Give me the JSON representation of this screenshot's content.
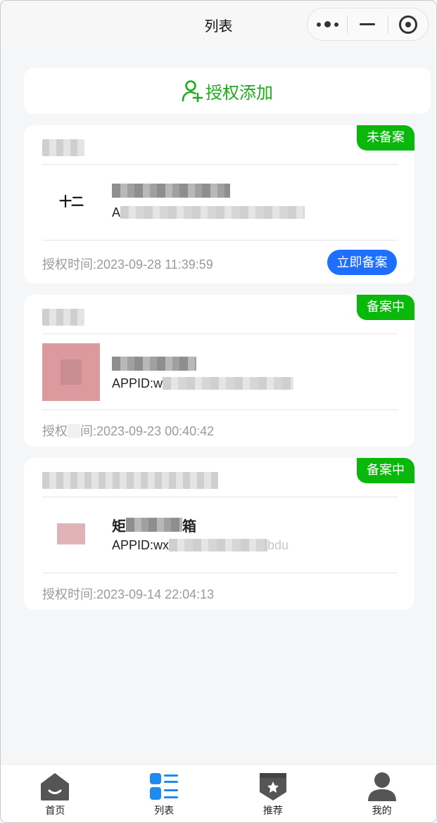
{
  "nav": {
    "title": "列表"
  },
  "auth_button": {
    "label": "授权添加"
  },
  "cards": [
    {
      "name": "",
      "status": "未备案",
      "logo_text": "十二",
      "appid_prefix": "A",
      "auth_time": "授权时间:2023-09-28 11:39:59",
      "action": "立即备案"
    },
    {
      "name": "",
      "status": "备案中",
      "appid_prefix": "APPID:w",
      "auth_time_prefix": "授权",
      "auth_time_suffix": "间:2023-09-23 00:40:42"
    },
    {
      "name": "",
      "status": "备案中",
      "title_start": "矩",
      "title_end": "箱",
      "appid_prefix": "APPID:wx",
      "appid_suffix": "bdu",
      "auth_time": "授权时间:2023-09-14 22:04:13"
    }
  ],
  "tabs": [
    {
      "label": "首页",
      "icon": "home-icon"
    },
    {
      "label": "列表",
      "icon": "list-icon"
    },
    {
      "label": "推荐",
      "icon": "recommend-badge-icon"
    },
    {
      "label": "我的",
      "icon": "user-icon"
    }
  ],
  "colors": {
    "accent_green": "#1aad19",
    "status_green": "#09b80b",
    "action_blue": "#1e6fff",
    "tab_active_blue": "#1e8bf0"
  }
}
